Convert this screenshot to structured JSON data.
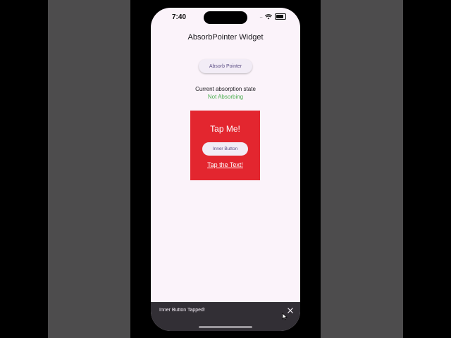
{
  "status_bar": {
    "time": "7:40",
    "signal": "....",
    "icons": [
      "wifi-icon",
      "battery-icon"
    ]
  },
  "app": {
    "title": "AbsorbPointer Widget"
  },
  "controls": {
    "absorb_button_label": "Absorb Pointer"
  },
  "state": {
    "label": "Current absorption state",
    "value": "Not Absorbing",
    "value_color": "#4caf50"
  },
  "target_box": {
    "color": "#e3262f",
    "title": "Tap Me!",
    "inner_button_label": "Inner Button",
    "link_text": "Tap the Text!"
  },
  "snackbar": {
    "message": "Inner Button Tapped!",
    "close_icon": "close-icon"
  },
  "colors": {
    "background": "#fbf3fa",
    "button_bg": "#f2ecf6",
    "button_text": "#5d4f86",
    "snackbar_bg": "#322f35"
  }
}
